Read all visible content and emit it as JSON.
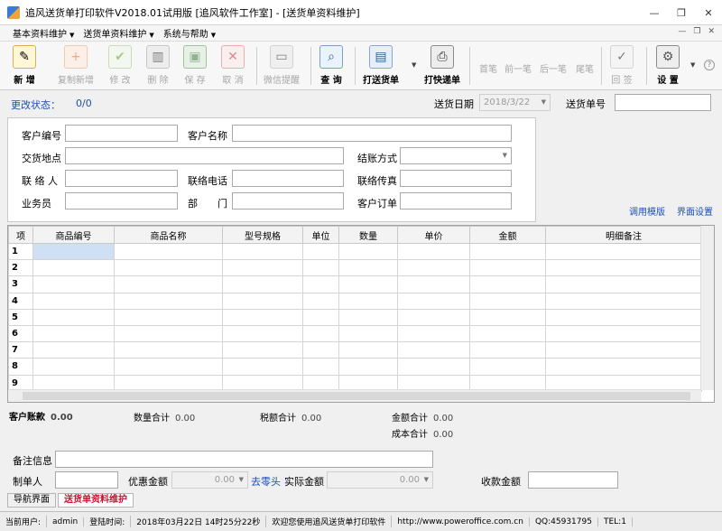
{
  "window": {
    "title": "追风送货单打印软件V2018.01试用版 [追风软件工作室] - [送货单资料维护]",
    "controls": [
      "—",
      "❐",
      "✕"
    ]
  },
  "menu": {
    "items": [
      "基本资料维护",
      "送货单资料维护",
      "系统与帮助"
    ],
    "right_controls": [
      "—",
      "❐",
      "✕"
    ]
  },
  "toolbar": {
    "new": "新 增",
    "copy_new": "复制新增",
    "edit": "修 改",
    "delete": "删 除",
    "save": "保 存",
    "cancel": "取 消",
    "wechat": "微信提醒",
    "query": "查 询",
    "print_delivery": "打送货单",
    "print_express": "打快递单",
    "first": "首笔",
    "prev": "前一笔",
    "next": "后一笔",
    "last": "尾笔",
    "review": "回 签",
    "settings": "设 置",
    "help_icon": "?"
  },
  "header": {
    "change_status_label": "更改状态：",
    "change_status_value": "0/0",
    "delivery_date_label": "送货日期",
    "delivery_date_value": "2018/3/22",
    "delivery_no_label": "送货单号"
  },
  "form": {
    "customer_no": "客户编号",
    "customer_name": "客户名称",
    "delivery_place": "交货地点",
    "settlement": "结账方式",
    "contact": "联 络 人",
    "phone": "联络电话",
    "fax": "联络传真",
    "salesman": "业务员",
    "department": "部　　门",
    "customer_order": "客户订单",
    "template_link": "调用模版",
    "layout_link": "界面设置"
  },
  "grid": {
    "columns": [
      "项",
      "商品编号",
      "商品名称",
      "型号规格",
      "单位",
      "数量",
      "单价",
      "金额",
      "明细备注"
    ],
    "rows": [
      "1",
      "2",
      "3",
      "4",
      "5",
      "6",
      "7",
      "8",
      "9"
    ]
  },
  "summary": {
    "customer_account_label": "客户账款",
    "customer_account_value": "0.00",
    "qty_total_label": "数量合计",
    "qty_total_value": "0.00",
    "tax_total_label": "税额合计",
    "tax_total_value": "0.00",
    "amount_total_label": "金额合计",
    "amount_total_value": "0.00",
    "cost_total_label": "成本合计",
    "cost_total_value": "0.00"
  },
  "footer": {
    "remarks_label": "备注信息",
    "creator_label": "制单人",
    "discount_label": "优惠金额",
    "discount_value": "0.00",
    "round_link": "去零头",
    "actual_label": "实际金额",
    "actual_value": "0.00",
    "received_label": "收款金额"
  },
  "tabs": [
    "导航界面",
    "送货单资料维护"
  ],
  "status": {
    "current_user_label": "当前用户:",
    "current_user": "admin",
    "login_time_label": "登陆时间:",
    "login_time": "2018年03月22日 14时25分22秒",
    "welcome": "欢迎您使用追风送货单打印软件",
    "url": "http://www.poweroffice.com.cn",
    "qq": "QQ:45931795",
    "tel": "TEL:1"
  },
  "colors": {
    "accent_blue": "#1a4fb3",
    "active_tab_red": "#c8102e",
    "selected_cell": "#cfe0f5"
  }
}
